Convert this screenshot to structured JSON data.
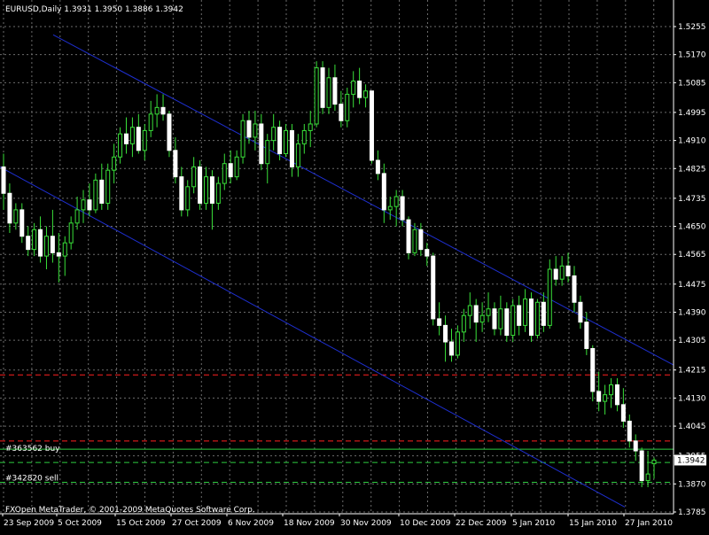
{
  "header": {
    "symbol_line": "EURUSD,Daily  1.3931 1.3950 1.3886 1.3942"
  },
  "footer": {
    "copyright": "FXOpen MetaTrader, © 2001-2009 MetaQuotes Software Corp."
  },
  "chart_data": {
    "type": "candlestick",
    "ylim": [
      1.3785,
      1.5255
    ],
    "grid": true,
    "y_ticks": [
      "1.5255",
      "1.5170",
      "1.5085",
      "1.4995",
      "1.4910",
      "1.4825",
      "1.4735",
      "1.4650",
      "1.4565",
      "1.4475",
      "1.4390",
      "1.4305",
      "1.4215",
      "1.4130",
      "1.4045",
      "1.3955",
      "1.3870",
      "1.3785"
    ],
    "x_tick_labels": [
      "23 Sep 2009",
      "5 Oct 2009",
      "15 Oct 2009",
      "27 Oct 2009",
      "6 Nov 2009",
      "18 Nov 2009",
      "30 Nov 2009",
      "10 Dec 2009",
      "22 Dec 2009",
      "5 Jan 2010",
      "15 Jan 2010",
      "27 Jan 2010"
    ],
    "current_price_label": "1.3942",
    "current_price": 1.3942,
    "orders": [
      {
        "label": "#363562 buy",
        "price": 1.3965
      },
      {
        "label": "#342820 sell",
        "price": 1.3875
      }
    ],
    "order_lines": [
      1.3975,
      1.3935,
      1.3875
    ],
    "stop_lines": [
      1.42,
      1.4
    ],
    "channel": {
      "upper": {
        "from": [
          "10 Sep 2009",
          1.523
        ],
        "to": [
          "30 Jan 2010",
          1.423
        ]
      },
      "lower": {
        "from": [
          "25 Sep 2009",
          1.483
        ],
        "to": [
          "25 Jan 2010",
          1.38
        ]
      }
    },
    "candles": [
      [
        1.483,
        1.487,
        1.47,
        1.475
      ],
      [
        1.475,
        1.478,
        1.463,
        1.466
      ],
      [
        1.466,
        1.472,
        1.464,
        1.47
      ],
      [
        1.47,
        1.472,
        1.46,
        1.462
      ],
      [
        1.462,
        1.465,
        1.456,
        1.458
      ],
      [
        1.458,
        1.466,
        1.456,
        1.464
      ],
      [
        1.464,
        1.468,
        1.454,
        1.456
      ],
      [
        1.456,
        1.465,
        1.452,
        1.462
      ],
      [
        1.462,
        1.47,
        1.454,
        1.457
      ],
      [
        1.457,
        1.463,
        1.448,
        1.456
      ],
      [
        1.456,
        1.462,
        1.45,
        1.46
      ],
      [
        1.46,
        1.468,
        1.458,
        1.466
      ],
      [
        1.466,
        1.474,
        1.464,
        1.47
      ],
      [
        1.47,
        1.476,
        1.466,
        1.473
      ],
      [
        1.473,
        1.478,
        1.468,
        1.47
      ],
      [
        1.47,
        1.481,
        1.469,
        1.479
      ],
      [
        1.479,
        1.484,
        1.47,
        1.472
      ],
      [
        1.472,
        1.484,
        1.47,
        1.482
      ],
      [
        1.482,
        1.49,
        1.478,
        1.486
      ],
      [
        1.486,
        1.495,
        1.484,
        1.493
      ],
      [
        1.493,
        1.498,
        1.487,
        1.49
      ],
      [
        1.49,
        1.498,
        1.486,
        1.495
      ],
      [
        1.495,
        1.499,
        1.487,
        1.488
      ],
      [
        1.488,
        1.496,
        1.485,
        1.494
      ],
      [
        1.494,
        1.503,
        1.492,
        1.499
      ],
      [
        1.499,
        1.505,
        1.495,
        1.501
      ],
      [
        1.501,
        1.505,
        1.497,
        1.499
      ],
      [
        1.499,
        1.5,
        1.486,
        1.488
      ],
      [
        1.488,
        1.492,
        1.478,
        1.48
      ],
      [
        1.48,
        1.483,
        1.468,
        1.47
      ],
      [
        1.47,
        1.479,
        1.468,
        1.477
      ],
      [
        1.477,
        1.486,
        1.475,
        1.483
      ],
      [
        1.483,
        1.485,
        1.47,
        1.472
      ],
      [
        1.472,
        1.483,
        1.47,
        1.48
      ],
      [
        1.48,
        1.482,
        1.464,
        1.472
      ],
      [
        1.472,
        1.48,
        1.47,
        1.478
      ],
      [
        1.478,
        1.487,
        1.476,
        1.484
      ],
      [
        1.484,
        1.488,
        1.478,
        1.48
      ],
      [
        1.48,
        1.488,
        1.479,
        1.486
      ],
      [
        1.486,
        1.499,
        1.484,
        1.497
      ],
      [
        1.497,
        1.5,
        1.49,
        1.492
      ],
      [
        1.492,
        1.5,
        1.488,
        1.496
      ],
      [
        1.496,
        1.499,
        1.482,
        1.484
      ],
      [
        1.484,
        1.493,
        1.478,
        1.491
      ],
      [
        1.491,
        1.499,
        1.488,
        1.495
      ],
      [
        1.495,
        1.497,
        1.485,
        1.487
      ],
      [
        1.487,
        1.496,
        1.486,
        1.494
      ],
      [
        1.494,
        1.496,
        1.48,
        1.483
      ],
      [
        1.483,
        1.493,
        1.48,
        1.49
      ],
      [
        1.49,
        1.496,
        1.487,
        1.494
      ],
      [
        1.494,
        1.5,
        1.489,
        1.496
      ],
      [
        1.496,
        1.515,
        1.495,
        1.513
      ],
      [
        1.513,
        1.515,
        1.499,
        1.501
      ],
      [
        1.501,
        1.513,
        1.499,
        1.51
      ],
      [
        1.51,
        1.514,
        1.5,
        1.502
      ],
      [
        1.502,
        1.506,
        1.495,
        1.497
      ],
      [
        1.497,
        1.507,
        1.495,
        1.505
      ],
      [
        1.505,
        1.512,
        1.501,
        1.509
      ],
      [
        1.509,
        1.513,
        1.502,
        1.504
      ],
      [
        1.504,
        1.508,
        1.501,
        1.506
      ],
      [
        1.506,
        1.506,
        1.484,
        1.485
      ],
      [
        1.485,
        1.488,
        1.479,
        1.481
      ],
      [
        1.481,
        1.484,
        1.466,
        1.47
      ],
      [
        1.47,
        1.474,
        1.467,
        1.471
      ],
      [
        1.471,
        1.476,
        1.465,
        1.474
      ],
      [
        1.474,
        1.476,
        1.465,
        1.467
      ],
      [
        1.467,
        1.468,
        1.455,
        1.457
      ],
      [
        1.457,
        1.466,
        1.456,
        1.464
      ],
      [
        1.464,
        1.466,
        1.456,
        1.458
      ],
      [
        1.458,
        1.46,
        1.453,
        1.456
      ],
      [
        1.456,
        1.457,
        1.435,
        1.437
      ],
      [
        1.437,
        1.442,
        1.432,
        1.435
      ],
      [
        1.435,
        1.438,
        1.424,
        1.43
      ],
      [
        1.43,
        1.434,
        1.424,
        1.426
      ],
      [
        1.426,
        1.435,
        1.425,
        1.433
      ],
      [
        1.433,
        1.44,
        1.43,
        1.438
      ],
      [
        1.438,
        1.445,
        1.434,
        1.441
      ],
      [
        1.441,
        1.443,
        1.43,
        1.436
      ],
      [
        1.436,
        1.442,
        1.433,
        1.438
      ],
      [
        1.438,
        1.445,
        1.436,
        1.44
      ],
      [
        1.44,
        1.442,
        1.432,
        1.434
      ],
      [
        1.434,
        1.444,
        1.432,
        1.44
      ],
      [
        1.44,
        1.442,
        1.43,
        1.432
      ],
      [
        1.432,
        1.443,
        1.43,
        1.441
      ],
      [
        1.441,
        1.444,
        1.432,
        1.435
      ],
      [
        1.435,
        1.446,
        1.433,
        1.443
      ],
      [
        1.443,
        1.445,
        1.43,
        1.432
      ],
      [
        1.432,
        1.443,
        1.431,
        1.442
      ],
      [
        1.442,
        1.445,
        1.433,
        1.435
      ],
      [
        1.435,
        1.455,
        1.434,
        1.452
      ],
      [
        1.452,
        1.456,
        1.447,
        1.449
      ],
      [
        1.449,
        1.456,
        1.447,
        1.453
      ],
      [
        1.453,
        1.457,
        1.448,
        1.45
      ],
      [
        1.45,
        1.453,
        1.439,
        1.442
      ],
      [
        1.442,
        1.444,
        1.434,
        1.436
      ],
      [
        1.436,
        1.439,
        1.426,
        1.428
      ],
      [
        1.428,
        1.429,
        1.412,
        1.415
      ],
      [
        1.415,
        1.421,
        1.409,
        1.412
      ],
      [
        1.412,
        1.417,
        1.408,
        1.414
      ],
      [
        1.414,
        1.419,
        1.41,
        1.417
      ],
      [
        1.417,
        1.419,
        1.409,
        1.411
      ],
      [
        1.411,
        1.416,
        1.404,
        1.406
      ],
      [
        1.406,
        1.408,
        1.398,
        1.4
      ],
      [
        1.4,
        1.402,
        1.394,
        1.397
      ],
      [
        1.397,
        1.398,
        1.386,
        1.388
      ],
      [
        1.388,
        1.397,
        1.386,
        1.39
      ],
      [
        1.3931,
        1.395,
        1.3886,
        1.3942
      ]
    ]
  }
}
